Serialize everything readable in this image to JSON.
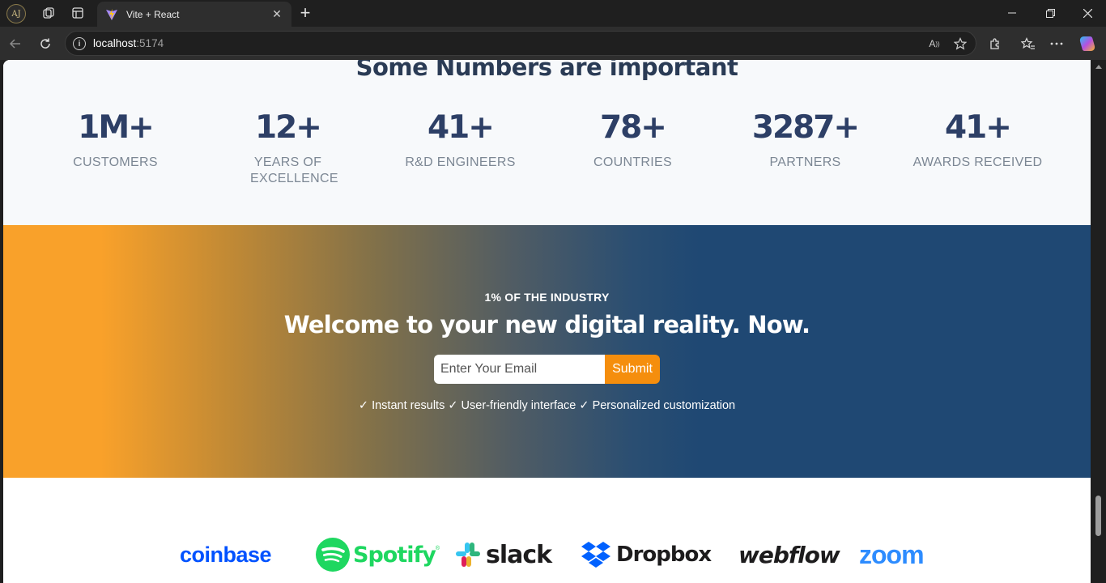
{
  "browser": {
    "profile_initials": "AJ",
    "tab_title": "Vite + React",
    "url_host": "localhost",
    "url_port": ":5174"
  },
  "stats": {
    "title": "Some Numbers are important",
    "items": [
      {
        "value": "1M+",
        "label": "CUSTOMERS"
      },
      {
        "value": "12+",
        "label": "YEARS OF EXCELLENCE"
      },
      {
        "value": "41+",
        "label": "R&D ENGINEERS"
      },
      {
        "value": "78+",
        "label": "COUNTRIES"
      },
      {
        "value": "3287+",
        "label": "PARTNERS"
      },
      {
        "value": "41+",
        "label": "AWARDS RECEIVED"
      }
    ]
  },
  "hero": {
    "eyebrow": "1% OF THE INDUSTRY",
    "title": "Welcome to your new digital reality. Now.",
    "email_placeholder": "Enter Your Email",
    "submit_label": "Submit",
    "features": "✓ Instant results ✓ User-friendly interface ✓ Personalized customization"
  },
  "logos": [
    {
      "name": "coinbase",
      "color": "#0052ff"
    },
    {
      "name": "Spotify",
      "color": "#1ed760"
    },
    {
      "name": "slack",
      "color": "#1d1c1d"
    },
    {
      "name": "Dropbox",
      "color": "#1d1c1d"
    },
    {
      "name": "webflow",
      "color": "#1d1c1d"
    },
    {
      "name": "zoom",
      "color": "#2d8cff"
    }
  ],
  "colors": {
    "accent_orange": "#f58e0d",
    "hero_blue": "#1f4873",
    "stat_number": "#2d3f66"
  }
}
